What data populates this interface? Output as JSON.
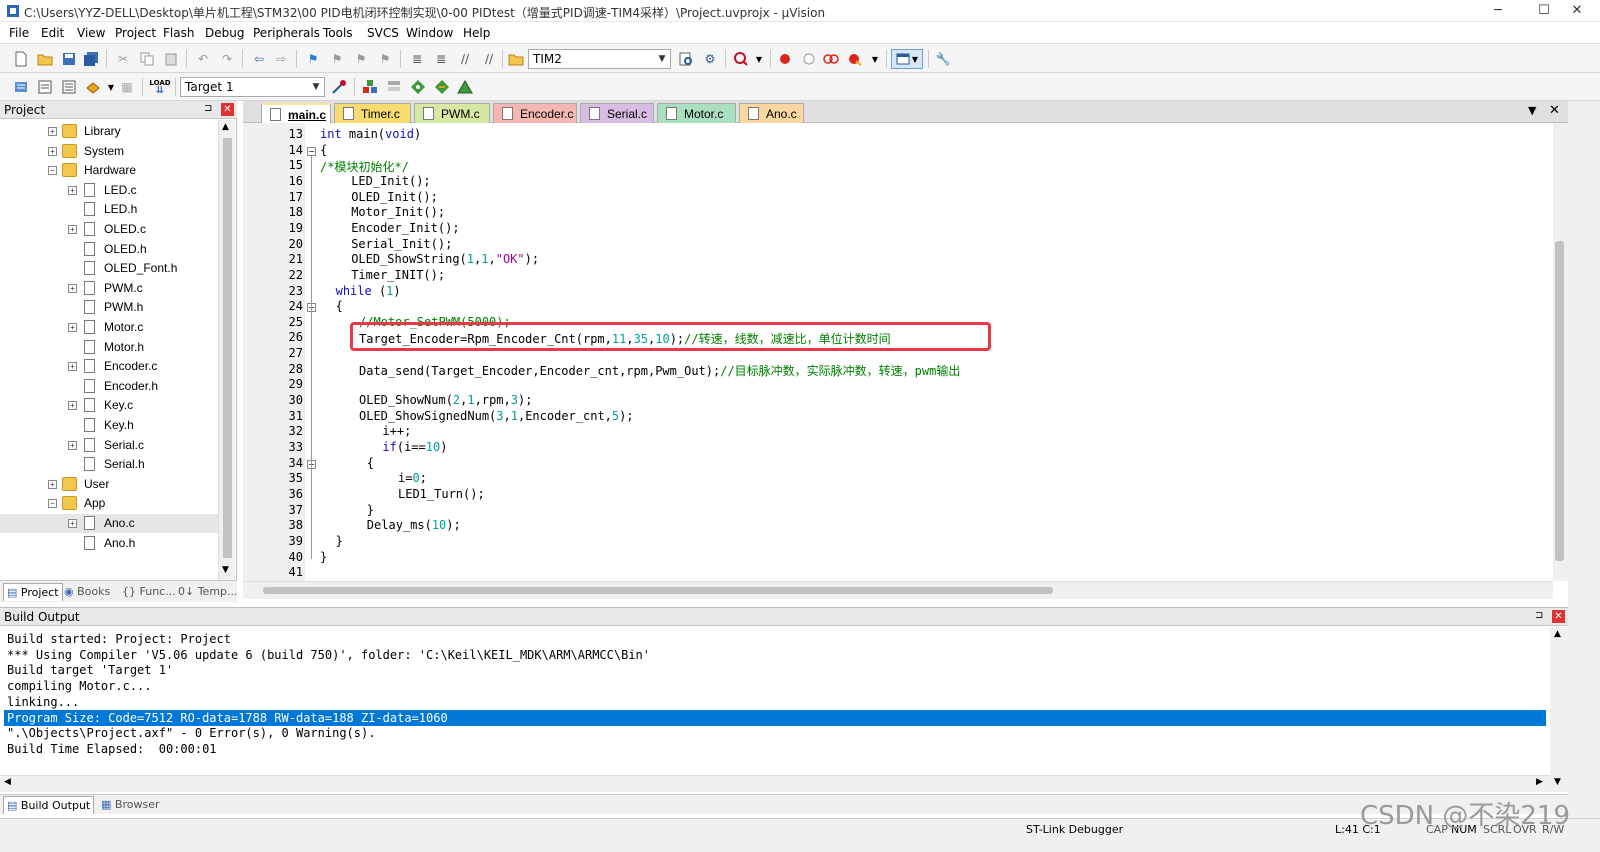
{
  "window": {
    "title": "C:\\Users\\YYZ-DELL\\Desktop\\单片机工程\\STM32\\00 PID电机闭环控制实现\\0-00  PIDtest（增量式PID调速-TIM4采样）\\Project.uvprojx - µVision",
    "minimize": "─",
    "maximize": "☐",
    "close": "✕"
  },
  "menu": [
    "File",
    "Edit",
    "View",
    "Project",
    "Flash",
    "Debug",
    "Peripherals",
    "Tools",
    "SVCS",
    "Window",
    "Help"
  ],
  "toolbar": {
    "find_combo": "TIM2",
    "target_combo": "Target 1"
  },
  "project_panel": {
    "title": "Project",
    "pin": "⊐",
    "close": "✕",
    "tree": [
      {
        "label": "Library",
        "type": "folder",
        "level": 0,
        "expander": "+"
      },
      {
        "label": "System",
        "type": "folder",
        "level": 0,
        "expander": "+"
      },
      {
        "label": "Hardware",
        "type": "folder-open",
        "level": 0,
        "expander": "−"
      },
      {
        "label": "LED.c",
        "type": "file",
        "level": 1,
        "expander": "+"
      },
      {
        "label": "LED.h",
        "type": "file",
        "level": 1,
        "expander": ""
      },
      {
        "label": "OLED.c",
        "type": "file",
        "level": 1,
        "expander": "+"
      },
      {
        "label": "OLED.h",
        "type": "file",
        "level": 1,
        "expander": ""
      },
      {
        "label": "OLED_Font.h",
        "type": "file",
        "level": 1,
        "expander": ""
      },
      {
        "label": "PWM.c",
        "type": "file",
        "level": 1,
        "expander": "+"
      },
      {
        "label": "PWM.h",
        "type": "file",
        "level": 1,
        "expander": ""
      },
      {
        "label": "Motor.c",
        "type": "file",
        "level": 1,
        "expander": "+"
      },
      {
        "label": "Motor.h",
        "type": "file",
        "level": 1,
        "expander": ""
      },
      {
        "label": "Encoder.c",
        "type": "file",
        "level": 1,
        "expander": "+"
      },
      {
        "label": "Encoder.h",
        "type": "file",
        "level": 1,
        "expander": ""
      },
      {
        "label": "Key.c",
        "type": "file",
        "level": 1,
        "expander": "+"
      },
      {
        "label": "Key.h",
        "type": "file",
        "level": 1,
        "expander": ""
      },
      {
        "label": "Serial.c",
        "type": "file",
        "level": 1,
        "expander": "+"
      },
      {
        "label": "Serial.h",
        "type": "file",
        "level": 1,
        "expander": ""
      },
      {
        "label": "User",
        "type": "folder",
        "level": 0,
        "expander": "+"
      },
      {
        "label": "App",
        "type": "folder-open",
        "level": 0,
        "expander": "−"
      },
      {
        "label": "Ano.c",
        "type": "file",
        "level": 1,
        "expander": "+",
        "selected": true
      },
      {
        "label": "Ano.h",
        "type": "file",
        "level": 1,
        "expander": ""
      }
    ],
    "tabs": [
      "Project",
      "Books",
      "{} Func...",
      "0↓ Temp..."
    ]
  },
  "editor": {
    "tabs": [
      {
        "label": "main.c",
        "color": "#f9e79f",
        "active": true
      },
      {
        "label": "Timer.c",
        "color": "#f7dc6f"
      },
      {
        "label": "PWM.c",
        "color": "#d5e8a4"
      },
      {
        "label": "Encoder.c",
        "color": "#f5b7b1"
      },
      {
        "label": "Serial.c",
        "color": "#d7bde2"
      },
      {
        "label": "Motor.c",
        "color": "#a9dfbf"
      },
      {
        "label": "Ano.c",
        "color": "#fad7a0"
      }
    ],
    "dropdown": "▼",
    "close": "✕",
    "lines": [
      {
        "n": "13",
        "html": "<span class='kw'>int</span> main(<span class='kw'>void</span>)",
        "indent": 0
      },
      {
        "n": "14",
        "html": "{",
        "indent": 0
      },
      {
        "n": "15",
        "html": "<span class='cmt'>/*模块初始化*/</span>",
        "indent": 0
      },
      {
        "n": "16",
        "html": "LED_Init();",
        "indent": 4
      },
      {
        "n": "17",
        "html": "OLED_Init();",
        "indent": 4
      },
      {
        "n": "18",
        "html": "Motor_Init();",
        "indent": 4
      },
      {
        "n": "19",
        "html": "Encoder_Init();",
        "indent": 4
      },
      {
        "n": "20",
        "html": "Serial_Init();",
        "indent": 4
      },
      {
        "n": "21",
        "html": "OLED_ShowString(<span class='num'>1</span>,<span class='num'>1</span>,<span class='str'>\"OK\"</span>);",
        "indent": 4
      },
      {
        "n": "22",
        "html": "Timer_INIT();",
        "indent": 4
      },
      {
        "n": "23",
        "html": "<span class='kw'>while</span> (<span class='num'>1</span>)",
        "indent": 2
      },
      {
        "n": "24",
        "html": "{",
        "indent": 2
      },
      {
        "n": "25",
        "html": "<span class='cmt'>//Motor_SetPWM(5000);</span>",
        "indent": 5
      },
      {
        "n": "26",
        "html": "Target_Encoder=Rpm_Encoder_Cnt(rpm,<span class='num'>11</span>,<span class='num'>35</span>,<span class='num'>10</span>);<span class='cmt'>//转速，线数，减速比，单位计数时间</span>",
        "indent": 5
      },
      {
        "n": "27",
        "html": "",
        "indent": 0
      },
      {
        "n": "28",
        "html": "Data_send(Target_Encoder,Encoder_cnt,rpm,Pwm_Out);<span class='cmt'>//目标脉冲数，实际脉冲数，转速，pwm输出</span>",
        "indent": 5
      },
      {
        "n": "29",
        "html": "",
        "indent": 0
      },
      {
        "n": "30",
        "html": "OLED_ShowNum(<span class='num'>2</span>,<span class='num'>1</span>,rpm,<span class='num'>3</span>);",
        "indent": 5
      },
      {
        "n": "31",
        "html": "OLED_ShowSignedNum(<span class='num'>3</span>,<span class='num'>1</span>,Encoder_cnt,<span class='num'>5</span>);",
        "indent": 5
      },
      {
        "n": "32",
        "html": "i++;",
        "indent": 8
      },
      {
        "n": "33",
        "html": "<span class='kw'>if</span>(i==<span class='num'>10</span>)",
        "indent": 8
      },
      {
        "n": "34",
        "html": "{",
        "indent": 6
      },
      {
        "n": "35",
        "html": "i=<span class='num'>0</span>;",
        "indent": 10
      },
      {
        "n": "36",
        "html": "LED1_Turn();",
        "indent": 10
      },
      {
        "n": "37",
        "html": "}",
        "indent": 6
      },
      {
        "n": "38",
        "html": "Delay_ms(<span class='num'>10</span>);",
        "indent": 6
      },
      {
        "n": "39",
        "html": "}",
        "indent": 2
      },
      {
        "n": "40",
        "html": "}",
        "indent": 0
      },
      {
        "n": "41",
        "html": "",
        "indent": 0
      }
    ]
  },
  "build": {
    "title": "Build Output",
    "pin": "⊐",
    "close": "✕",
    "lines": [
      "Build started: Project: Project",
      "*** Using Compiler 'V5.06 update 6 (build 750)', folder: 'C:\\Keil\\KEIL_MDK\\ARM\\ARMCC\\Bin'",
      "Build target 'Target 1'",
      "compiling Motor.c...",
      "linking...",
      "Program Size: Code=7512 RO-data=1788 RW-data=188 ZI-data=1060",
      "\".\\Objects\\Project.axf\" - 0 Error(s), 0 Warning(s).",
      "Build Time Elapsed:  00:00:01"
    ],
    "selected_index": 5,
    "tabs": [
      "Build Output",
      "Browser"
    ]
  },
  "status": {
    "debugger": "ST-Link Debugger",
    "position": "L:41 C:1",
    "indicators": [
      "CAP",
      "NUM",
      "SCRL",
      "OVR",
      "R/W"
    ]
  },
  "watermark": "CSDN @不染219"
}
